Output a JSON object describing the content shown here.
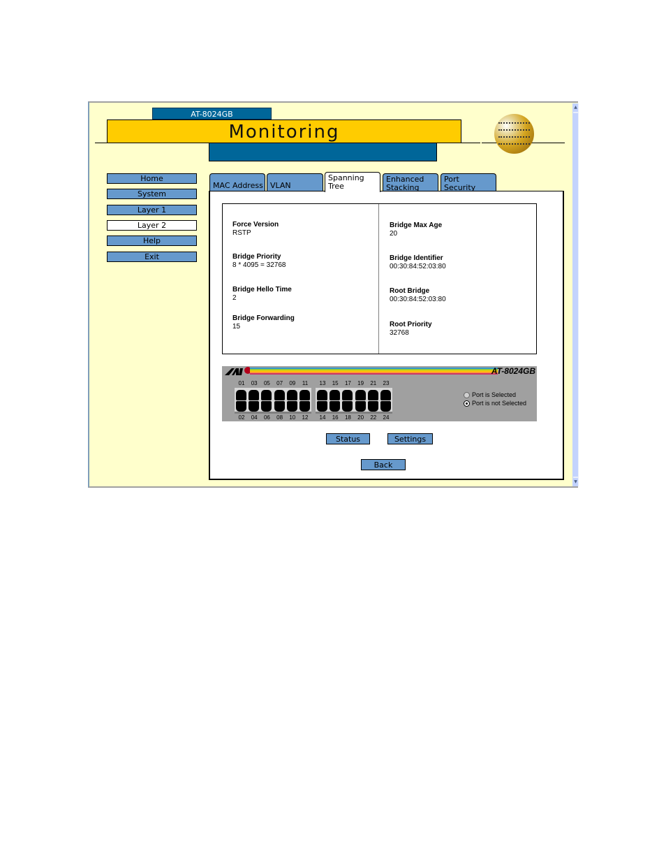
{
  "header": {
    "model": "AT-8024GB",
    "title": "Monitoring"
  },
  "sidebar": {
    "items": [
      {
        "label": "Home",
        "active": false
      },
      {
        "label": "System",
        "active": false
      },
      {
        "label": "Layer 1",
        "active": false
      },
      {
        "label": "Layer 2",
        "active": true
      },
      {
        "label": "Help",
        "active": false
      },
      {
        "label": "Exit",
        "active": false
      }
    ]
  },
  "tabs": [
    {
      "line1": "MAC Address",
      "line2": ""
    },
    {
      "line1": "VLAN",
      "line2": ""
    },
    {
      "line1": "Spanning",
      "line2": "Tree",
      "active": true
    },
    {
      "line1": "Enhanced",
      "line2": "Stacking"
    },
    {
      "line1": "Port",
      "line2": "Security"
    }
  ],
  "info": {
    "left": [
      {
        "label": "Force Version",
        "value": "RSTP"
      },
      {
        "label": "Bridge Priority",
        "value": "8 * 4095 = 32768"
      },
      {
        "label": "Bridge Hello Time",
        "value": "2"
      },
      {
        "label": "Bridge Forwarding",
        "value": "15"
      }
    ],
    "right": [
      {
        "label": "Bridge Max Age",
        "value": "20"
      },
      {
        "label": "Bridge Identifier",
        "value": "00:30:84:52:03:80"
      },
      {
        "label": "Root Bridge",
        "value": "00:30:84:52:03:80"
      },
      {
        "label": "Root Priority",
        "value": "32768"
      }
    ]
  },
  "switch": {
    "model_label": "AT-8024GB",
    "top_ports": [
      "01",
      "03",
      "05",
      "07",
      "09",
      "11",
      "13",
      "15",
      "17",
      "19",
      "21",
      "23"
    ],
    "bottom_ports": [
      "02",
      "04",
      "06",
      "08",
      "10",
      "12",
      "14",
      "16",
      "18",
      "20",
      "22",
      "24"
    ],
    "legend": {
      "selected": "Port is Selected",
      "not_selected": "Port is not Selected"
    },
    "stripe_colors": [
      "#3399cc",
      "#99cc33",
      "#ffcc00",
      "#ff9933",
      "#cc3366"
    ]
  },
  "buttons": {
    "status": "Status",
    "settings": "Settings",
    "back": "Back"
  }
}
